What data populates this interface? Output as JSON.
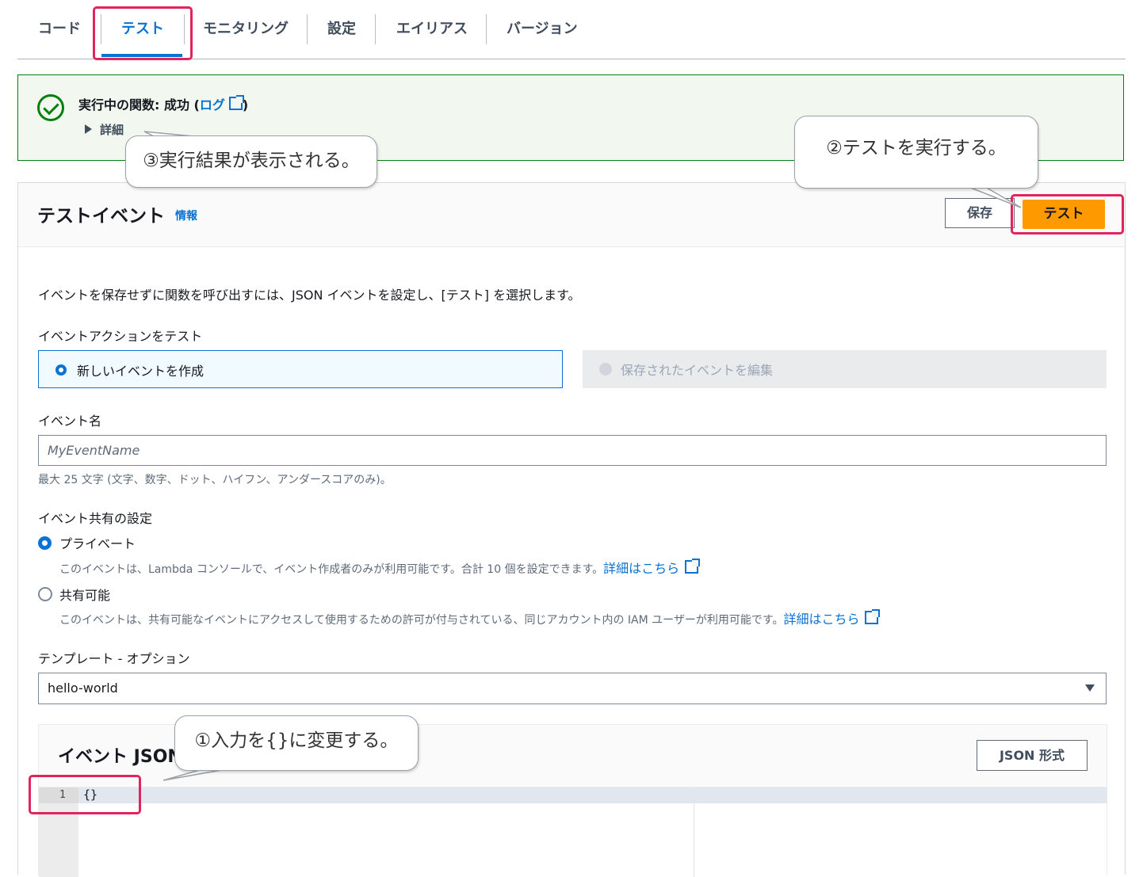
{
  "tabs": [
    {
      "label": "コード"
    },
    {
      "label": "テスト"
    },
    {
      "label": "モニタリング"
    },
    {
      "label": "設定"
    },
    {
      "label": "エイリアス"
    },
    {
      "label": "バージョン"
    }
  ],
  "banner": {
    "title_prefix": "実行中の関数: 成功 (",
    "log_link": "ログ",
    "title_suffix": ")",
    "details_label": "詳細"
  },
  "test_event": {
    "title": "テストイベント",
    "info_link": "情報",
    "save_button": "保存",
    "test_button": "テスト",
    "description": "イベントを保存せずに関数を呼び出すには、JSON イベントを設定し、[テスト] を選択します。",
    "action_label": "イベントアクションをテスト",
    "action_options": [
      "新しいイベントを作成",
      "保存されたイベントを編集"
    ],
    "event_name_label": "イベント名",
    "event_name_placeholder": "MyEventName",
    "event_name_help": "最大 25 文字 (文字、数字、ドット、ハイフン、アンダースコアのみ)。",
    "sharing_label": "イベント共有の設定",
    "private_label": "プライベート",
    "private_desc": "このイベントは、Lambda コンソールで、イベント作成者のみが利用可能です。合計 10 個を設定できます。",
    "shareable_label": "共有可能",
    "shareable_desc": "このイベントは、共有可能なイベントにアクセスして使用するための許可が付与されている、同じアカウント内の IAM ユーザーが利用可能です。",
    "learn_more": "詳細はこちら",
    "template_label": "テンプレート - オプション",
    "template_value": "hello-world",
    "json_title": "イベント JSON",
    "json_format_button": "JSON 形式",
    "line_number": "1",
    "code": "{}"
  },
  "callouts": {
    "step1": "①入力を{}に変更する。",
    "step2": "②テストを実行する。",
    "step3": "③実行結果が表示される。"
  },
  "colors": {
    "accent": "#0972d3",
    "success": "#037f0c",
    "primary_button": "#ff9900",
    "highlight": "#e0245e"
  }
}
